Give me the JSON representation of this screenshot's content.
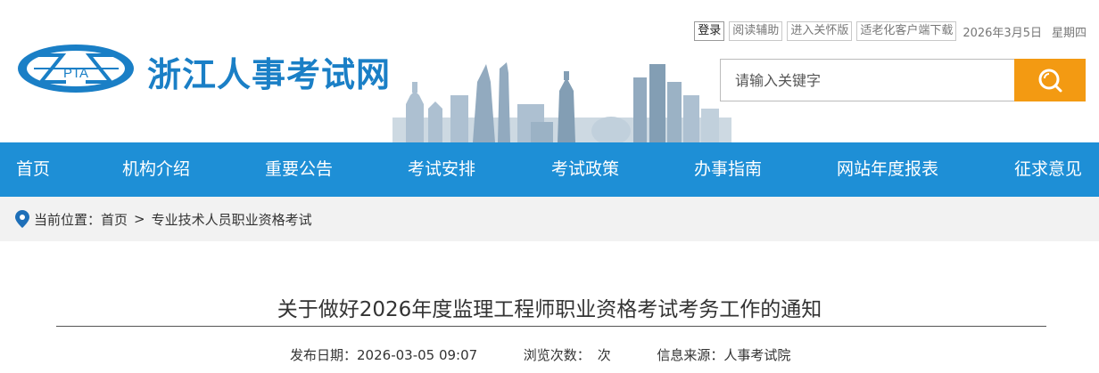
{
  "topbar": {
    "login": "登录",
    "reading_aid": "阅读辅助",
    "care_version": "进入关怀版",
    "elderly_client": "适老化客户端下载",
    "date": "2026年3月5日",
    "weekday": "星期四"
  },
  "logo": {
    "text": "PTA"
  },
  "site_title": "浙江人事考试网",
  "search": {
    "placeholder": "请输入关键字"
  },
  "nav": {
    "items": [
      {
        "label": "首页"
      },
      {
        "label": "机构介绍"
      },
      {
        "label": "重要公告"
      },
      {
        "label": "考试安排"
      },
      {
        "label": "考试政策"
      },
      {
        "label": "办事指南"
      },
      {
        "label": "网站年度报表"
      },
      {
        "label": "征求意见"
      }
    ]
  },
  "breadcrumb": {
    "prefix": "当前位置：",
    "home": "首页",
    "separator": ">",
    "current": "专业技术人员职业资格考试"
  },
  "article": {
    "title": "关于做好2026年度监理工程师职业资格考试考务工作的通知",
    "publish_label": "发布日期：",
    "publish_date": "2026-03-05 09:07",
    "views_label": "浏览次数：",
    "views_unit": "次",
    "source_label": "信息来源：",
    "source": "人事考试院"
  },
  "colors": {
    "brand_blue": "#1a7fc6",
    "nav_blue": "#1e8fd6",
    "search_orange": "#f39a12",
    "breadcrumb_bg": "#f2f2f2"
  }
}
